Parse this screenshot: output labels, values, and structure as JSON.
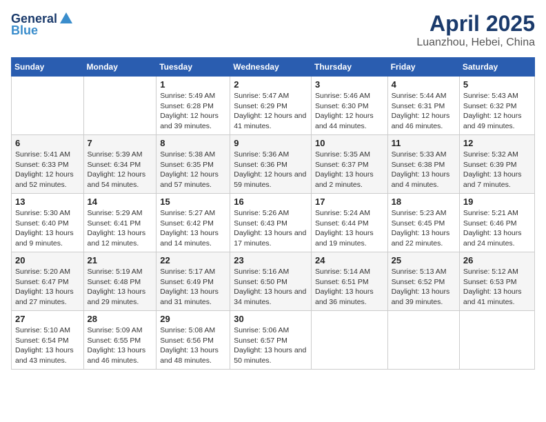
{
  "logo": {
    "general": "General",
    "blue": "Blue"
  },
  "title": "April 2025",
  "subtitle": "Luanzhou, Hebei, China",
  "weekdays": [
    "Sunday",
    "Monday",
    "Tuesday",
    "Wednesday",
    "Thursday",
    "Friday",
    "Saturday"
  ],
  "weeks": [
    [
      {
        "day": "",
        "sunrise": "",
        "sunset": "",
        "daylight": ""
      },
      {
        "day": "",
        "sunrise": "",
        "sunset": "",
        "daylight": ""
      },
      {
        "day": "1",
        "sunrise": "Sunrise: 5:49 AM",
        "sunset": "Sunset: 6:28 PM",
        "daylight": "Daylight: 12 hours and 39 minutes."
      },
      {
        "day": "2",
        "sunrise": "Sunrise: 5:47 AM",
        "sunset": "Sunset: 6:29 PM",
        "daylight": "Daylight: 12 hours and 41 minutes."
      },
      {
        "day": "3",
        "sunrise": "Sunrise: 5:46 AM",
        "sunset": "Sunset: 6:30 PM",
        "daylight": "Daylight: 12 hours and 44 minutes."
      },
      {
        "day": "4",
        "sunrise": "Sunrise: 5:44 AM",
        "sunset": "Sunset: 6:31 PM",
        "daylight": "Daylight: 12 hours and 46 minutes."
      },
      {
        "day": "5",
        "sunrise": "Sunrise: 5:43 AM",
        "sunset": "Sunset: 6:32 PM",
        "daylight": "Daylight: 12 hours and 49 minutes."
      }
    ],
    [
      {
        "day": "6",
        "sunrise": "Sunrise: 5:41 AM",
        "sunset": "Sunset: 6:33 PM",
        "daylight": "Daylight: 12 hours and 52 minutes."
      },
      {
        "day": "7",
        "sunrise": "Sunrise: 5:39 AM",
        "sunset": "Sunset: 6:34 PM",
        "daylight": "Daylight: 12 hours and 54 minutes."
      },
      {
        "day": "8",
        "sunrise": "Sunrise: 5:38 AM",
        "sunset": "Sunset: 6:35 PM",
        "daylight": "Daylight: 12 hours and 57 minutes."
      },
      {
        "day": "9",
        "sunrise": "Sunrise: 5:36 AM",
        "sunset": "Sunset: 6:36 PM",
        "daylight": "Daylight: 12 hours and 59 minutes."
      },
      {
        "day": "10",
        "sunrise": "Sunrise: 5:35 AM",
        "sunset": "Sunset: 6:37 PM",
        "daylight": "Daylight: 13 hours and 2 minutes."
      },
      {
        "day": "11",
        "sunrise": "Sunrise: 5:33 AM",
        "sunset": "Sunset: 6:38 PM",
        "daylight": "Daylight: 13 hours and 4 minutes."
      },
      {
        "day": "12",
        "sunrise": "Sunrise: 5:32 AM",
        "sunset": "Sunset: 6:39 PM",
        "daylight": "Daylight: 13 hours and 7 minutes."
      }
    ],
    [
      {
        "day": "13",
        "sunrise": "Sunrise: 5:30 AM",
        "sunset": "Sunset: 6:40 PM",
        "daylight": "Daylight: 13 hours and 9 minutes."
      },
      {
        "day": "14",
        "sunrise": "Sunrise: 5:29 AM",
        "sunset": "Sunset: 6:41 PM",
        "daylight": "Daylight: 13 hours and 12 minutes."
      },
      {
        "day": "15",
        "sunrise": "Sunrise: 5:27 AM",
        "sunset": "Sunset: 6:42 PM",
        "daylight": "Daylight: 13 hours and 14 minutes."
      },
      {
        "day": "16",
        "sunrise": "Sunrise: 5:26 AM",
        "sunset": "Sunset: 6:43 PM",
        "daylight": "Daylight: 13 hours and 17 minutes."
      },
      {
        "day": "17",
        "sunrise": "Sunrise: 5:24 AM",
        "sunset": "Sunset: 6:44 PM",
        "daylight": "Daylight: 13 hours and 19 minutes."
      },
      {
        "day": "18",
        "sunrise": "Sunrise: 5:23 AM",
        "sunset": "Sunset: 6:45 PM",
        "daylight": "Daylight: 13 hours and 22 minutes."
      },
      {
        "day": "19",
        "sunrise": "Sunrise: 5:21 AM",
        "sunset": "Sunset: 6:46 PM",
        "daylight": "Daylight: 13 hours and 24 minutes."
      }
    ],
    [
      {
        "day": "20",
        "sunrise": "Sunrise: 5:20 AM",
        "sunset": "Sunset: 6:47 PM",
        "daylight": "Daylight: 13 hours and 27 minutes."
      },
      {
        "day": "21",
        "sunrise": "Sunrise: 5:19 AM",
        "sunset": "Sunset: 6:48 PM",
        "daylight": "Daylight: 13 hours and 29 minutes."
      },
      {
        "day": "22",
        "sunrise": "Sunrise: 5:17 AM",
        "sunset": "Sunset: 6:49 PM",
        "daylight": "Daylight: 13 hours and 31 minutes."
      },
      {
        "day": "23",
        "sunrise": "Sunrise: 5:16 AM",
        "sunset": "Sunset: 6:50 PM",
        "daylight": "Daylight: 13 hours and 34 minutes."
      },
      {
        "day": "24",
        "sunrise": "Sunrise: 5:14 AM",
        "sunset": "Sunset: 6:51 PM",
        "daylight": "Daylight: 13 hours and 36 minutes."
      },
      {
        "day": "25",
        "sunrise": "Sunrise: 5:13 AM",
        "sunset": "Sunset: 6:52 PM",
        "daylight": "Daylight: 13 hours and 39 minutes."
      },
      {
        "day": "26",
        "sunrise": "Sunrise: 5:12 AM",
        "sunset": "Sunset: 6:53 PM",
        "daylight": "Daylight: 13 hours and 41 minutes."
      }
    ],
    [
      {
        "day": "27",
        "sunrise": "Sunrise: 5:10 AM",
        "sunset": "Sunset: 6:54 PM",
        "daylight": "Daylight: 13 hours and 43 minutes."
      },
      {
        "day": "28",
        "sunrise": "Sunrise: 5:09 AM",
        "sunset": "Sunset: 6:55 PM",
        "daylight": "Daylight: 13 hours and 46 minutes."
      },
      {
        "day": "29",
        "sunrise": "Sunrise: 5:08 AM",
        "sunset": "Sunset: 6:56 PM",
        "daylight": "Daylight: 13 hours and 48 minutes."
      },
      {
        "day": "30",
        "sunrise": "Sunrise: 5:06 AM",
        "sunset": "Sunset: 6:57 PM",
        "daylight": "Daylight: 13 hours and 50 minutes."
      },
      {
        "day": "",
        "sunrise": "",
        "sunset": "",
        "daylight": ""
      },
      {
        "day": "",
        "sunrise": "",
        "sunset": "",
        "daylight": ""
      },
      {
        "day": "",
        "sunrise": "",
        "sunset": "",
        "daylight": ""
      }
    ]
  ]
}
